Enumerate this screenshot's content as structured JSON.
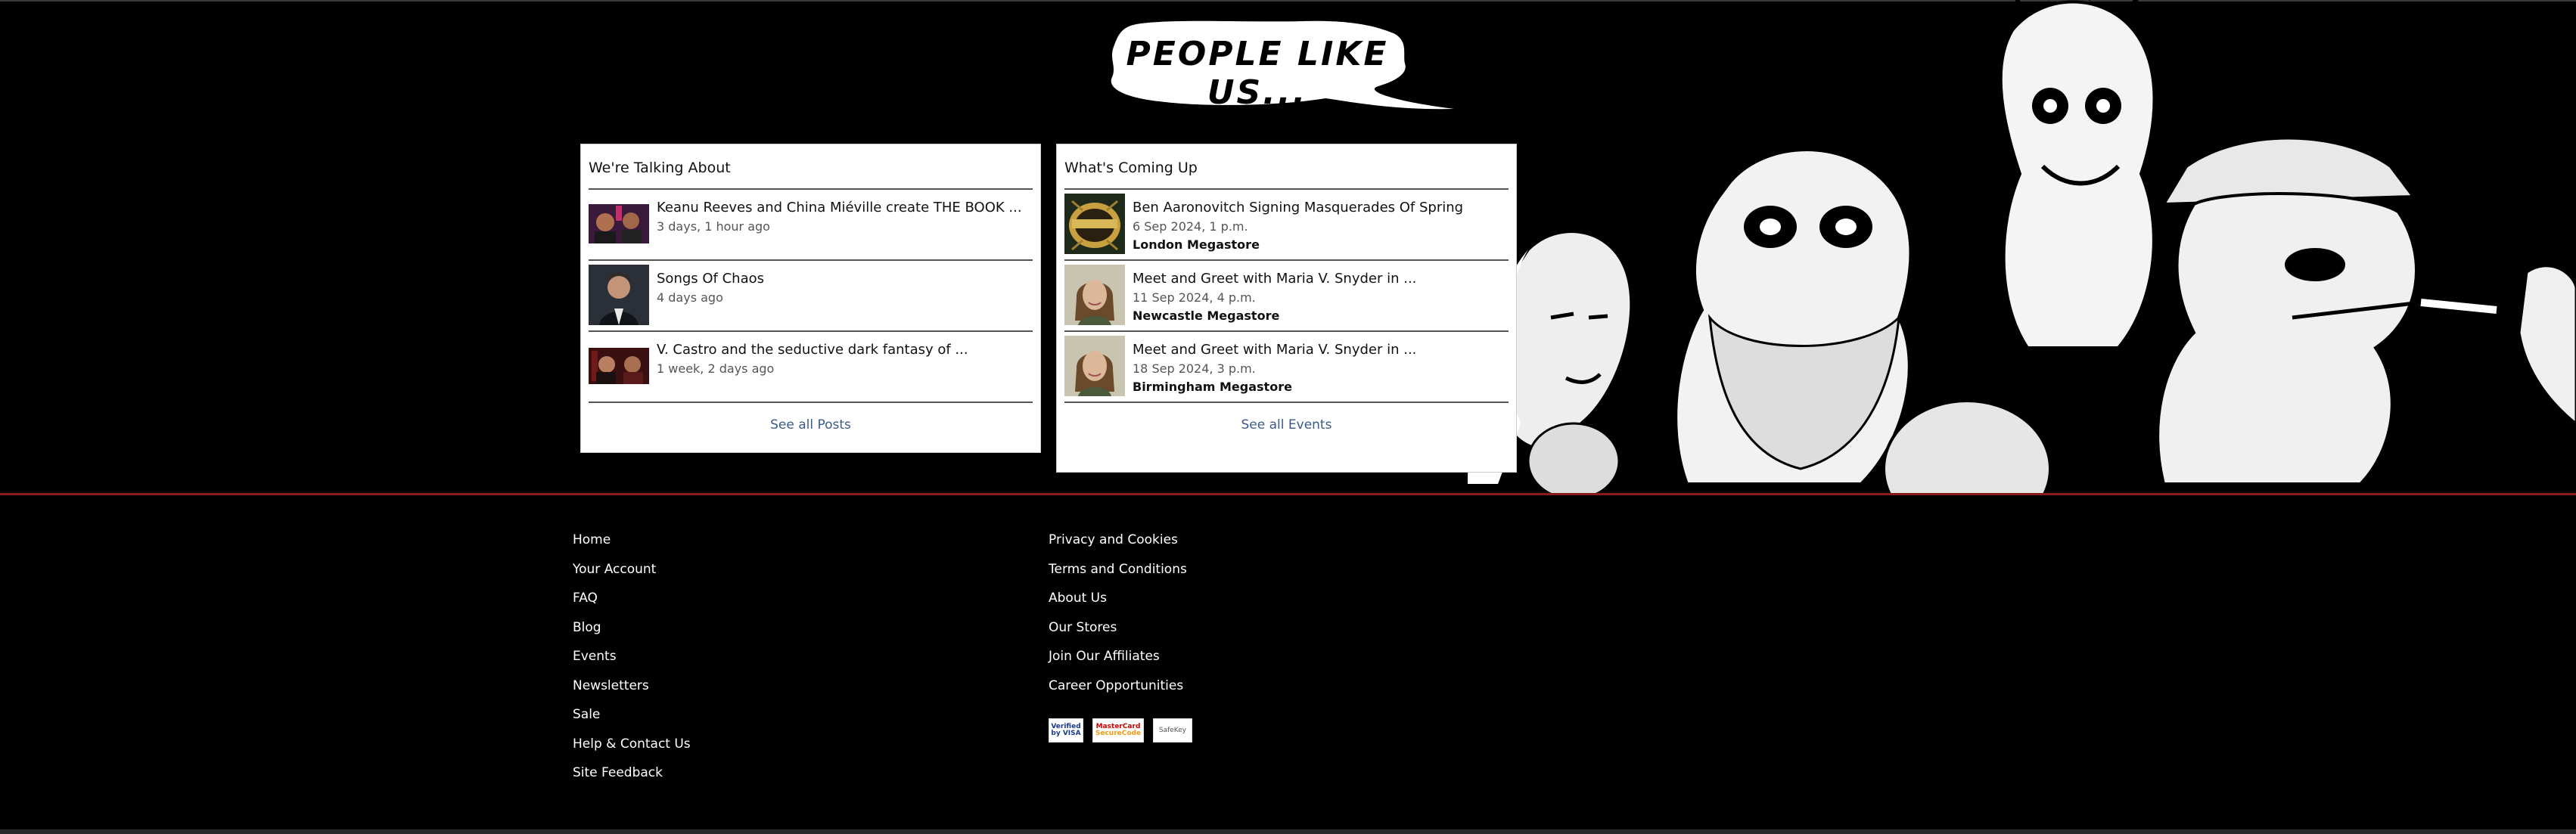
{
  "banner": {
    "text": "PEOPLE LIKE US..."
  },
  "posts": {
    "title": "We're Talking About",
    "items": [
      {
        "title": "Keanu Reeves and China Miéville create THE BOOK ...",
        "meta": "3 days, 1 hour ago"
      },
      {
        "title": "Songs Of Chaos",
        "meta": "4 days ago"
      },
      {
        "title": "V. Castro and the seductive dark fantasy of ...",
        "meta": "1 week, 2 days ago"
      }
    ],
    "see_all": "See all Posts"
  },
  "events": {
    "title": "What's Coming Up",
    "items": [
      {
        "title": "Ben Aaronovitch Signing Masquerades Of Spring",
        "date": "6 Sep 2024, 1 p.m.",
        "location": "London Megastore"
      },
      {
        "title": "Meet and Greet with Maria V. Snyder in ...",
        "date": "11 Sep 2024, 4 p.m.",
        "location": "Newcastle Megastore"
      },
      {
        "title": "Meet and Greet with Maria V. Snyder in ...",
        "date": "18 Sep 2024, 3 p.m.",
        "location": "Birmingham Megastore"
      }
    ],
    "see_all": "See all Events"
  },
  "footer": {
    "col1": [
      "Home",
      "Your Account",
      "FAQ",
      "Blog",
      "Events",
      "Newsletters",
      "Sale",
      "Help & Contact Us",
      "Site Feedback"
    ],
    "col2": [
      "Privacy and Cookies",
      "Terms and Conditions",
      "About Us",
      "Our Stores",
      "Join Our Affiliates",
      "Career Opportunities"
    ]
  },
  "payments": {
    "visa": "Verified by VISA",
    "mastercard_1": "MasterCard",
    "mastercard_2": "SecureCode",
    "safe": "SafeKey"
  },
  "colors": {
    "background": "#000000",
    "accent_line": "#8b1a1a",
    "link": "#3b5b8c"
  }
}
